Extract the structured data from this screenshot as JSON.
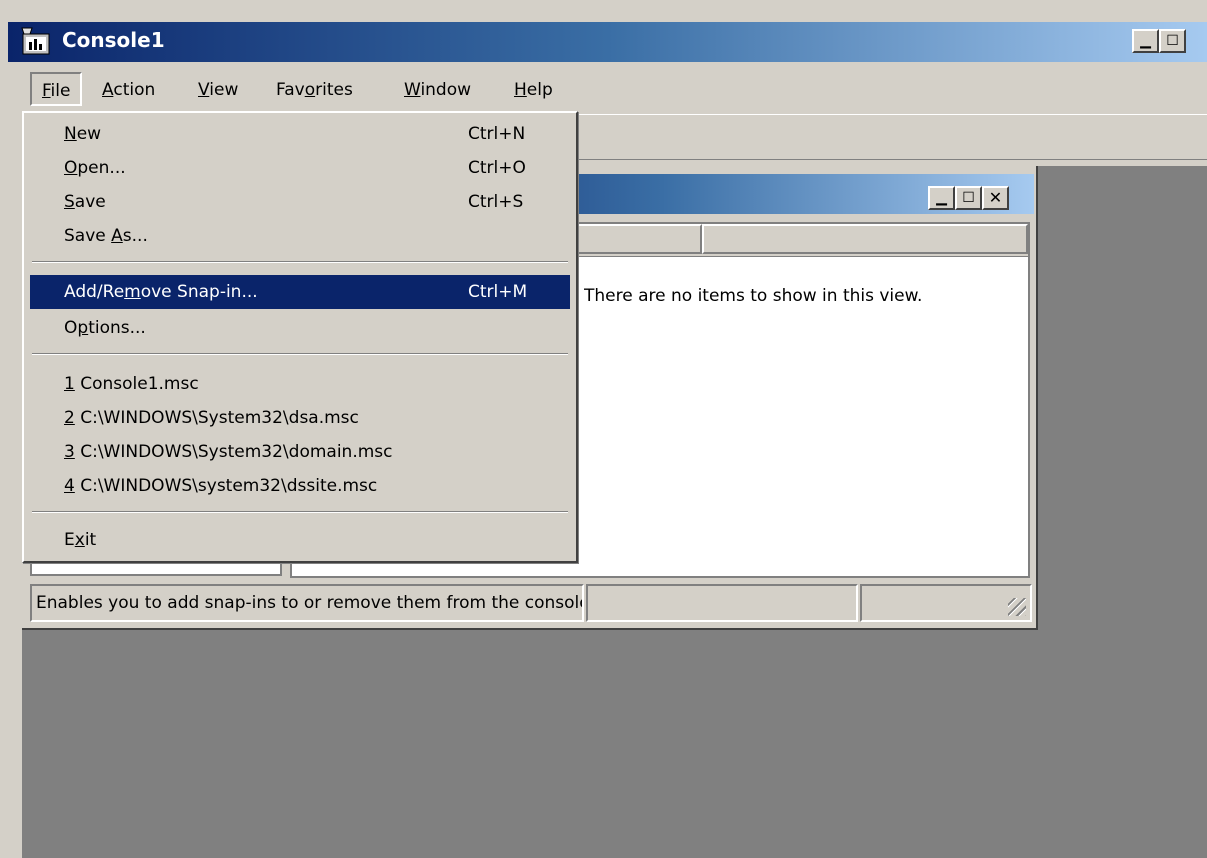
{
  "window": {
    "title": "Console1"
  },
  "menubar": {
    "file": "File",
    "action": "Action",
    "view": "View",
    "favorites": "Favorites",
    "window": "Window",
    "help": "Help"
  },
  "file_menu": {
    "new": {
      "label": "New",
      "shortcut": "Ctrl+N"
    },
    "open": {
      "label": "Open...",
      "shortcut": "Ctrl+O"
    },
    "save": {
      "label": "Save",
      "shortcut": "Ctrl+S"
    },
    "save_as": {
      "label": "Save As..."
    },
    "add_remove": {
      "label": "Add/Remove Snap-in...",
      "shortcut": "Ctrl+M"
    },
    "options": {
      "label": "Options..."
    },
    "recent": [
      {
        "num": "1",
        "path": " Console1.msc"
      },
      {
        "num": "2",
        "path": " C:\\WINDOWS\\System32\\dsa.msc"
      },
      {
        "num": "3",
        "path": " C:\\WINDOWS\\System32\\domain.msc"
      },
      {
        "num": "4",
        "path": " C:\\WINDOWS\\system32\\dssite.msc"
      }
    ],
    "exit": {
      "label": "Exit"
    }
  },
  "child": {
    "empty_message": "There are no items to show in this view."
  },
  "statusbar": {
    "text": "Enables you to add snap-ins to or remove them from the console."
  },
  "colors": {
    "titlebar_start": "#0a246a",
    "titlebar_end": "#a6caf0",
    "highlight": "#0a246a",
    "face": "#d4d0c8",
    "workspace": "#808080"
  }
}
